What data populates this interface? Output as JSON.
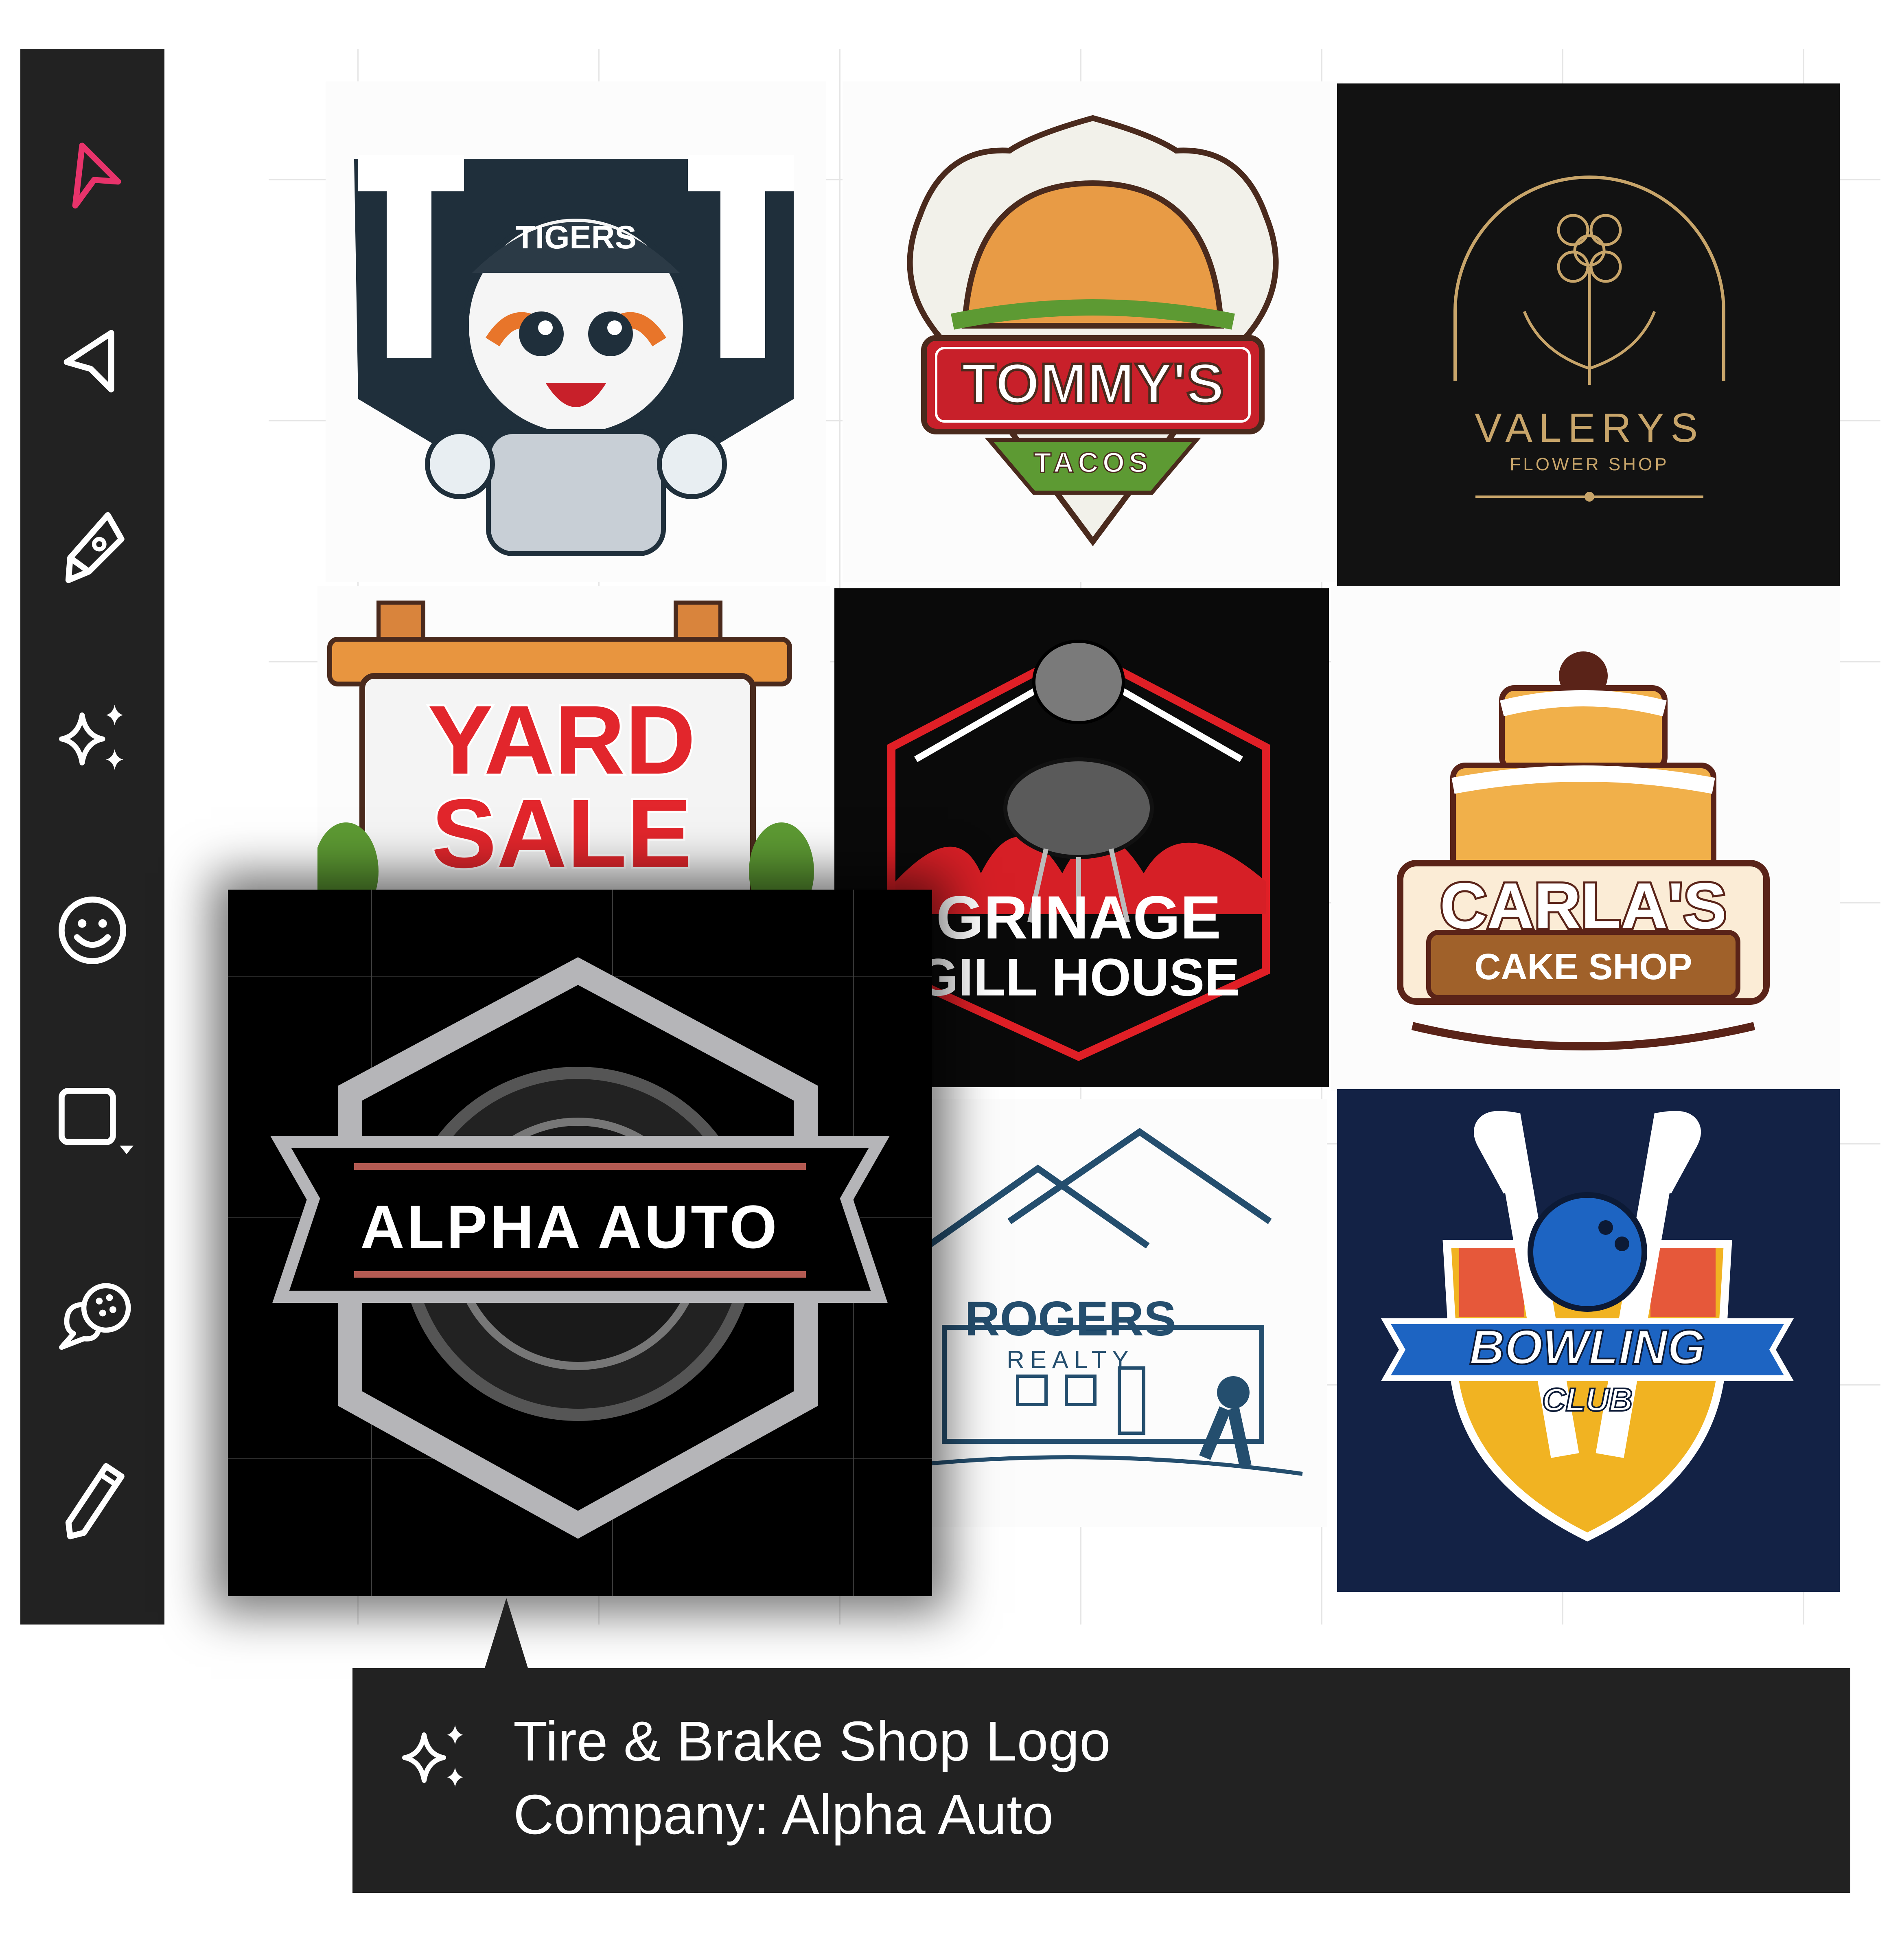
{
  "toolbar": {
    "tools": [
      {
        "name": "select",
        "icon": "select-arrow-icon",
        "active": true
      },
      {
        "name": "move",
        "icon": "navigate-arrow-icon",
        "active": false
      },
      {
        "name": "pen",
        "icon": "pen-nib-icon",
        "active": false
      },
      {
        "name": "ai-generate",
        "icon": "sparkles-icon",
        "active": false
      },
      {
        "name": "emoji",
        "icon": "smiley-icon",
        "active": false
      },
      {
        "name": "shapes",
        "icon": "square-shape-icon",
        "active": false
      },
      {
        "name": "comment",
        "icon": "comment-icon",
        "active": false
      },
      {
        "name": "pencil",
        "icon": "pencil-icon",
        "active": false
      }
    ],
    "active_color": "#e8336b"
  },
  "logos": {
    "tigers": {
      "title": "TIGERS"
    },
    "tacos": {
      "title": "TOMMY'S",
      "subtitle": "TACOS"
    },
    "valerys": {
      "title": "VALERYS",
      "subtitle": "FLOWER SHOP"
    },
    "yard_sale": {
      "line1": "YARD",
      "line2": "SALE"
    },
    "grill": {
      "line1": "GRINAGE",
      "line2": "GILL HOUSE"
    },
    "cake": {
      "title": "CARLA'S",
      "subtitle": "CAKE SHOP"
    },
    "realty": {
      "title": "ROGERS",
      "subtitle": "REALTY"
    },
    "bowling": {
      "title": "BOWLING",
      "subtitle": "CLUB"
    },
    "alpha": {
      "title": "ALPHA AUTO"
    }
  },
  "tooltip": {
    "icon": "sparkles-icon",
    "line1": "Tire & Brake Shop Logo",
    "line2": "Company: Alpha Auto"
  }
}
